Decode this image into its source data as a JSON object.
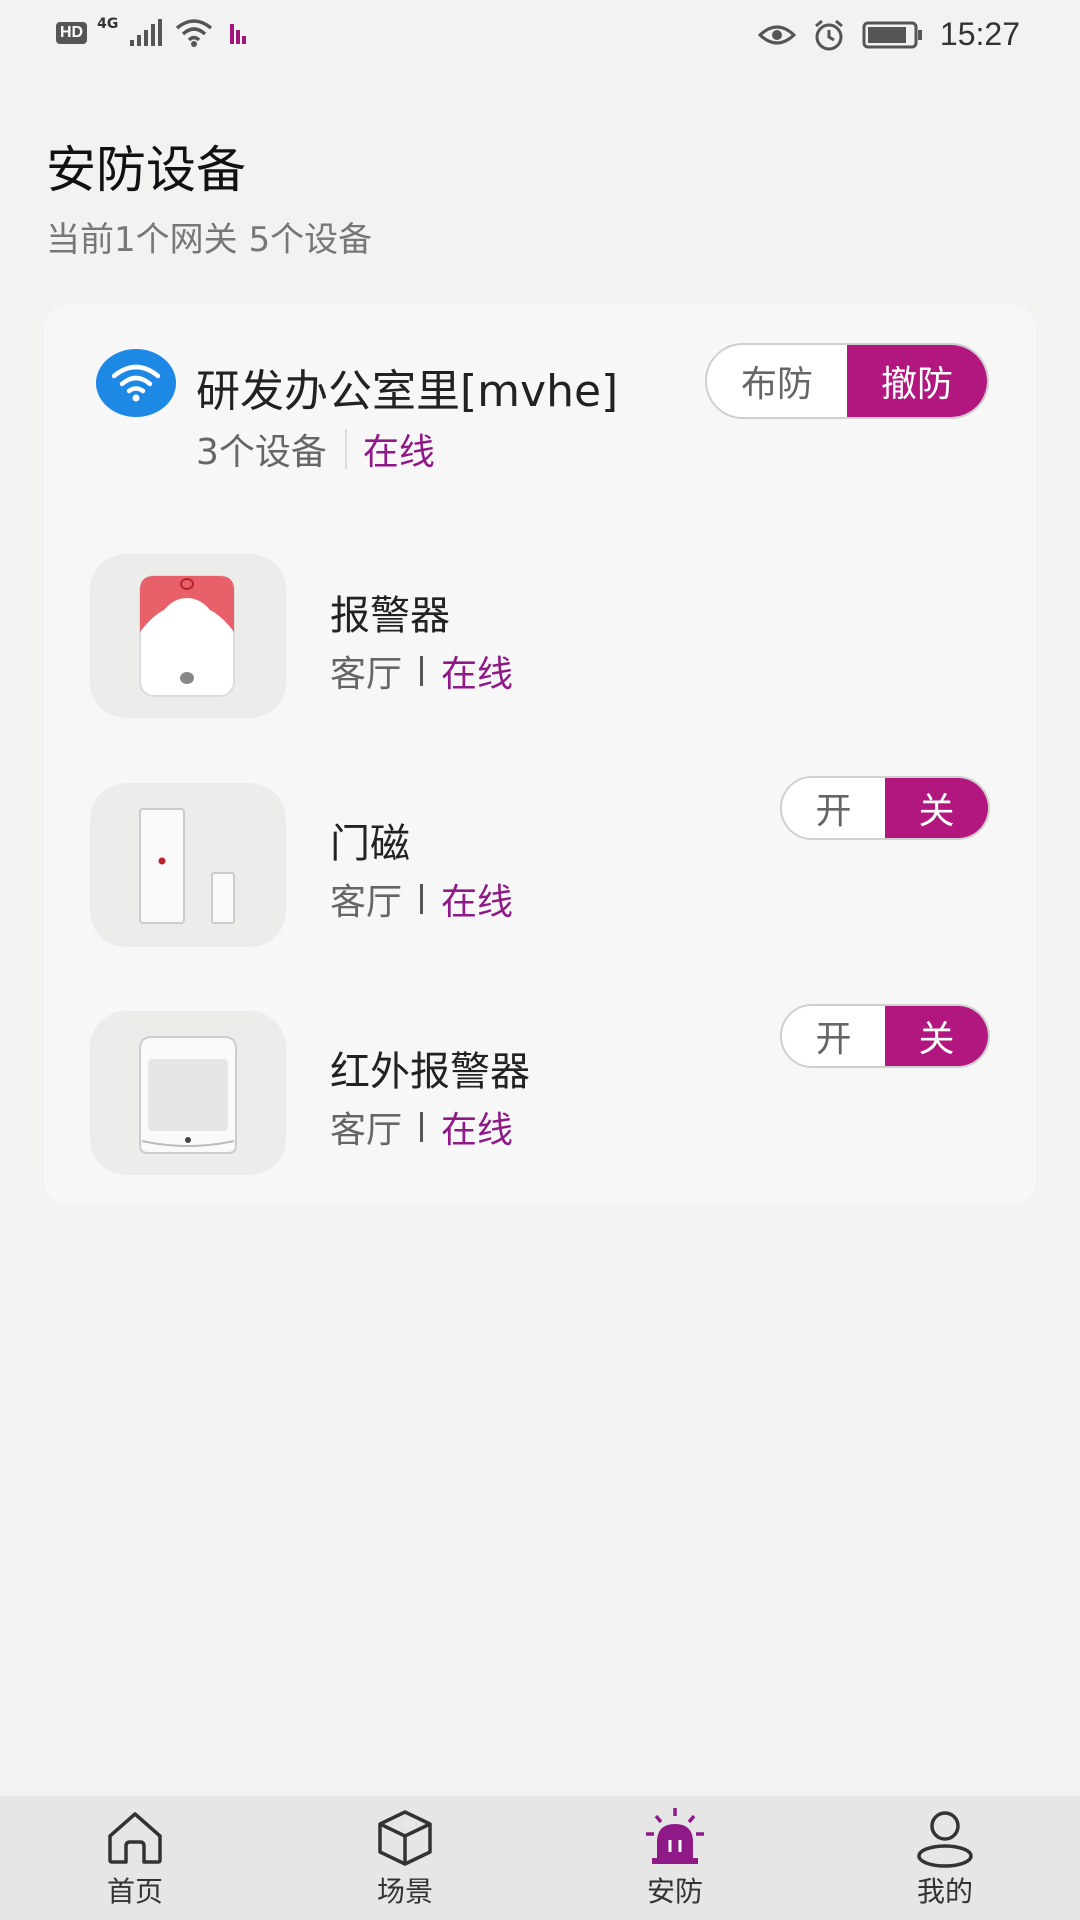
{
  "status_bar": {
    "hd": "HD",
    "network": "4G",
    "time": "15:27"
  },
  "page": {
    "title": "安防设备",
    "subtitle": "当前1个网关 5个设备"
  },
  "gateway": {
    "name": "研发办公室里[mvhe]",
    "device_count": "3个设备",
    "status": "在线",
    "arm_label": "布防",
    "disarm_label": "撤防",
    "selected": "撤防"
  },
  "devices": [
    {
      "name": "报警器",
      "room": "客厅",
      "status": "在线",
      "icon": "siren-device-image"
    },
    {
      "name": "门磁",
      "room": "客厅",
      "status": "在线",
      "icon": "door-sensor-image",
      "on_label": "开",
      "off_label": "关",
      "selected": "关"
    },
    {
      "name": "红外报警器",
      "room": "客厅",
      "status": "在线",
      "icon": "pir-sensor-image",
      "on_label": "开",
      "off_label": "关",
      "selected": "关"
    }
  ],
  "nav": [
    {
      "label": "首页",
      "icon": "home-icon"
    },
    {
      "label": "场景",
      "icon": "cube-icon"
    },
    {
      "label": "安防",
      "icon": "alarm-light-icon",
      "active": true
    },
    {
      "label": "我的",
      "icon": "user-icon"
    }
  ],
  "colors": {
    "accent": "#b1177f",
    "online": "#8f1a87",
    "wifi_blue": "#1e88e5",
    "siren_red": "#e8616a"
  }
}
